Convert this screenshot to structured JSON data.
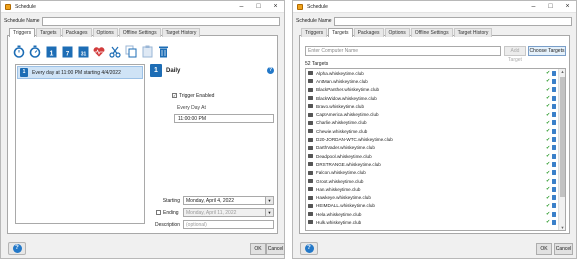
{
  "window1": {
    "title": "Schedule",
    "name_label": "Schedule Name",
    "tabs": [
      "Triggers",
      "Targets",
      "Packages",
      "Options",
      "Offline Settings",
      "Target History"
    ],
    "active_tab": "Triggers",
    "trigger_item": "Every day at 11:00 PM starting 4/4/2022",
    "detail": {
      "title": "Daily",
      "trigger_enabled": "Trigger Enabled",
      "every_day_at": "Every Day At",
      "time": "11:00:00 PM",
      "starting_label": "Starting",
      "starting_value": "Monday,  April  4, 2022",
      "ending_label": "Ending",
      "ending_value": "Monday,  April 11, 2022",
      "description_label": "Description",
      "description_placeholder": "(optional)"
    },
    "ok": "OK",
    "cancel": "Cancel"
  },
  "window2": {
    "title": "Schedule",
    "name_label": "Schedule Name",
    "tabs": [
      "Triggers",
      "Targets",
      "Packages",
      "Options",
      "Offline Settings",
      "Target History"
    ],
    "active_tab": "Targets",
    "computer_placeholder": "Enter Computer Name",
    "add_label": "Add Target",
    "choose_label": "Choose Targets",
    "count_label": "52 Targets",
    "targets": [
      "Alpha.whiskeytime.club",
      "AntMan.whiskeytime.club",
      "BlackPanther.whiskeytime.club",
      "BlackWidow.whiskeytime.club",
      "Bravo.whiskeytime.club",
      "CaptAmerica.whiskeytime.club",
      "Charlie.whiskeytime.club",
      "Chewie.whiskeytime.club",
      "D20-JORDAN-WTC.whiskeytime.club",
      "DarthVader.whiskeytime.club",
      "Deadpool.whiskeytime.club",
      "DRSTRANGE.whiskeytime.club",
      "Falcon.whiskeytime.club",
      "Groot.whiskeytime.club",
      "Han.whiskeytime.club",
      "Hawkeye.whiskeytime.club",
      "HEIMDALL.whiskeytime.club",
      "Hela.whiskeytime.club",
      "Hulk.whiskeytime.club"
    ],
    "ok": "OK",
    "cancel": "Cancel"
  },
  "colors": {
    "accent": "#2378c8",
    "selection": "#cfe3f6",
    "ok_check": "#2a9a2a"
  }
}
